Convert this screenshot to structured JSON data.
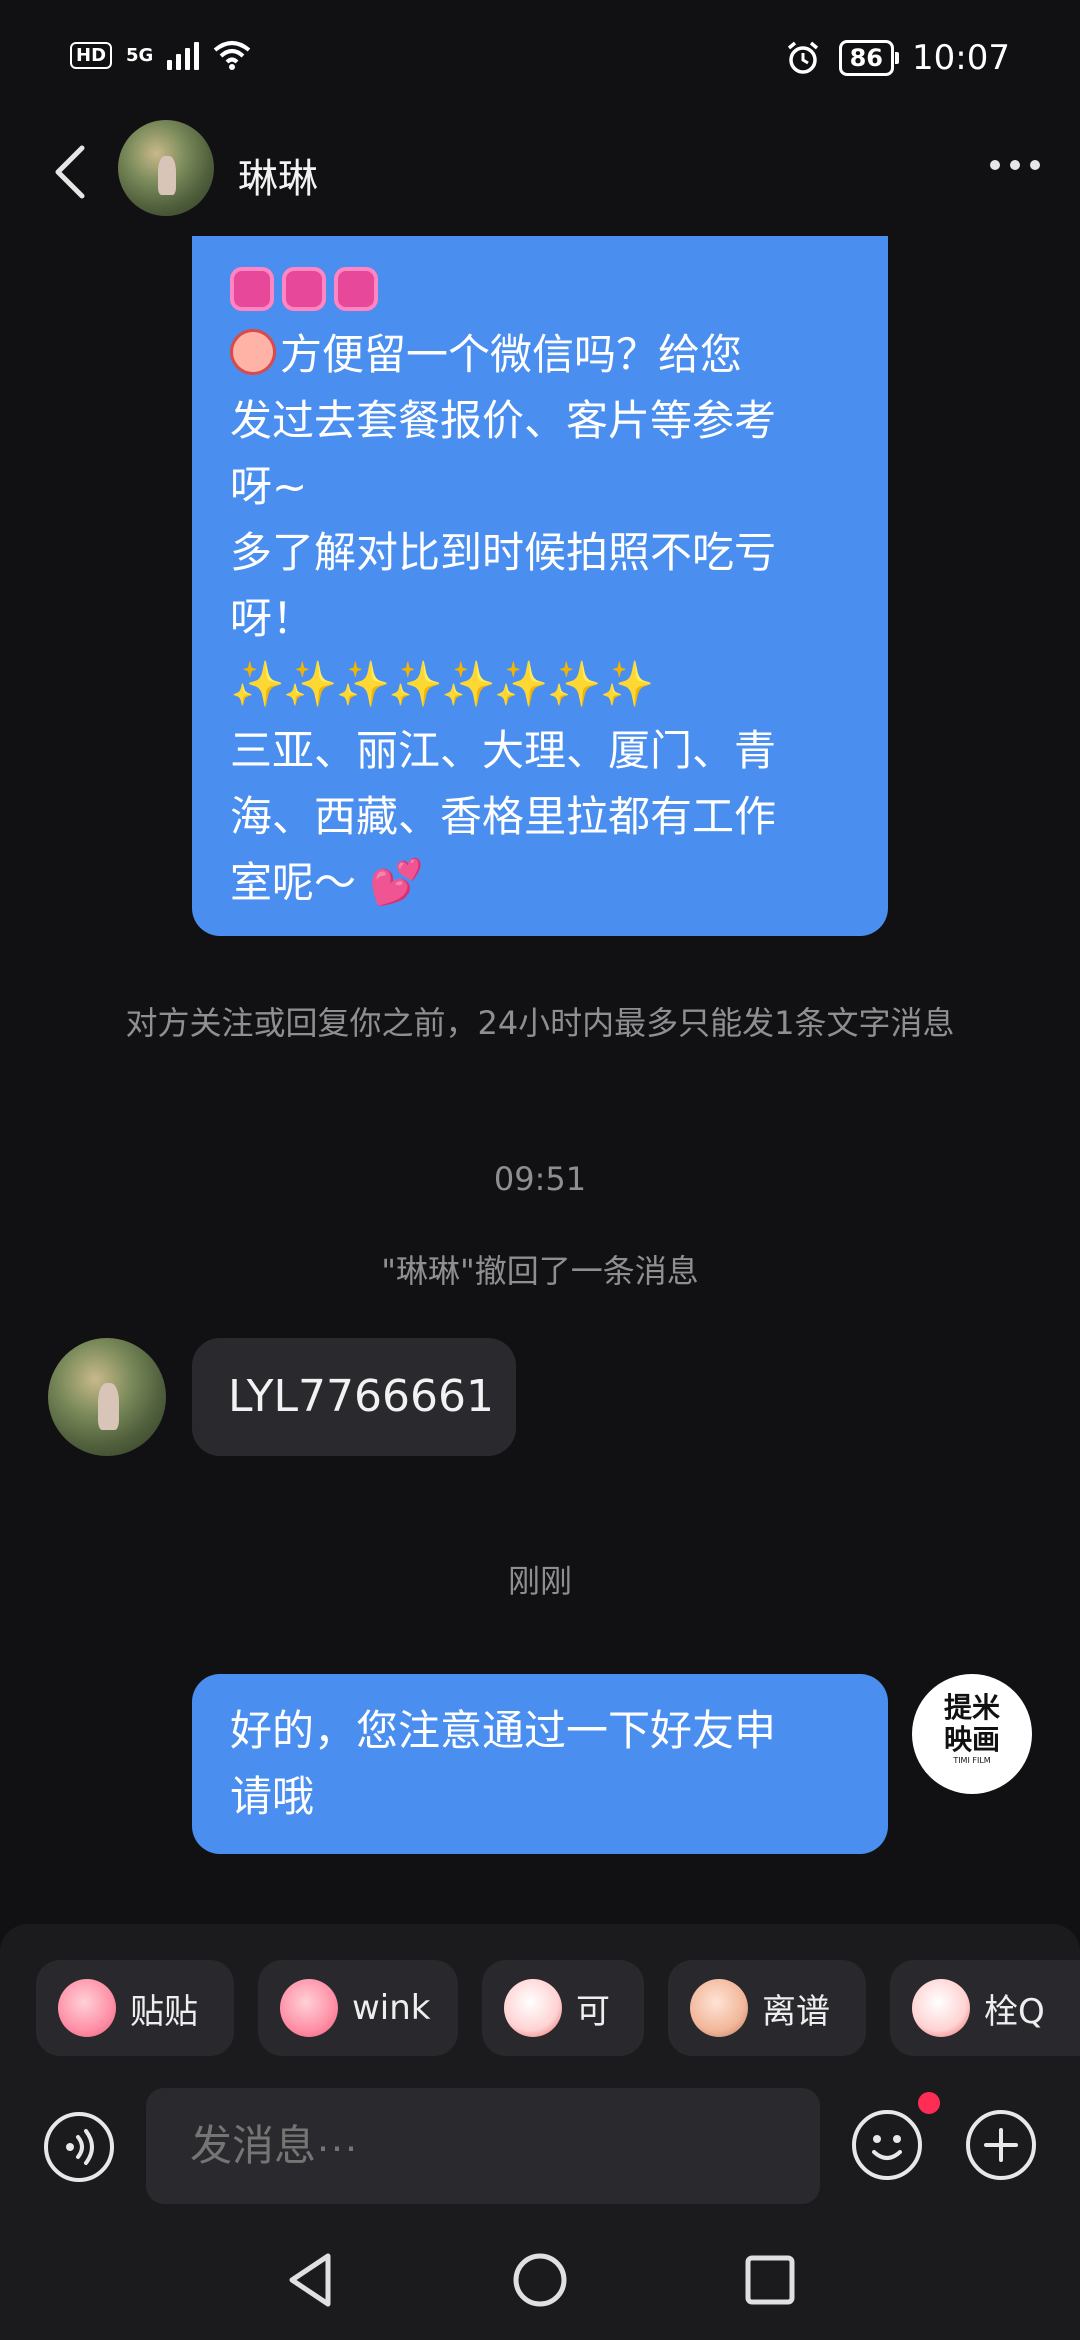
{
  "status_bar": {
    "network_hd": "HD",
    "network_5g": "5G",
    "battery": "86",
    "time": "10:07",
    "icons": [
      "hd-icon",
      "signal-icon",
      "wifi-icon",
      "alarm-icon",
      "battery-icon"
    ]
  },
  "header": {
    "contact_name": "琳琳",
    "icons": [
      "back-arrow-icon",
      "more-options-icon"
    ]
  },
  "messages": {
    "sent_1": {
      "line_1": "方便留一个微信吗？给您",
      "line_2": "发过去套餐报价、客片等参考",
      "line_3": "呀~",
      "line_4": "多了解对比到时候拍照不吃亏",
      "line_5": "呀！",
      "sparkles": "✨✨✨✨✨✨✨✨",
      "line_6": "三亚、丽江、大理、厦门、青",
      "line_7": "海、西藏、香格里拉都有工作",
      "line_8": "室呢～"
    },
    "system_notice": "对方关注或回复你之前，24小时内最多只能发1条文字消息",
    "timestamp_1": "09:51",
    "recall_notice": "\"琳琳\"撤回了一条消息",
    "received_1": "LYL7766661",
    "timestamp_2": "刚刚",
    "sent_2_line_1": "好的，您注意通过一下好友申",
    "sent_2_line_2": "请哦"
  },
  "studio_logo": {
    "line_1": "提米",
    "line_2": "映画",
    "sub": "TIMI FILM"
  },
  "quick_stickers": [
    {
      "label": "贴贴",
      "icon": "sticker-tietie-icon"
    },
    {
      "label": "wink",
      "icon": "sticker-wink-icon"
    },
    {
      "label": "可",
      "icon": "sticker-ke-icon"
    },
    {
      "label": "离谱",
      "icon": "sticker-lipu-icon"
    },
    {
      "label": "栓Q",
      "icon": "sticker-shuanq-icon"
    }
  ],
  "composer": {
    "placeholder": "发消息···",
    "icons": [
      "voice-icon",
      "emoji-icon",
      "plus-icon"
    ]
  },
  "colors": {
    "background": "#111113",
    "sent_bubble": "#4a8ef0",
    "received_bubble": "#2a2a2e",
    "system_text": "#8f8f93",
    "notification_dot": "#ff2d55"
  }
}
